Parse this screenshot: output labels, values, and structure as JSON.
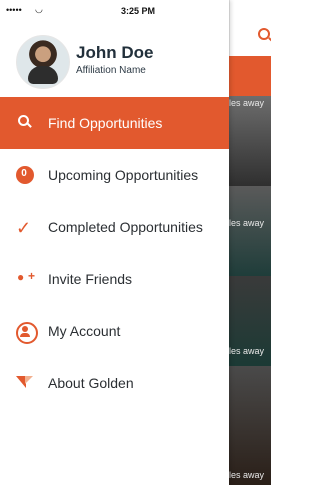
{
  "status": {
    "signal": "•••••",
    "time": "3:25 PM"
  },
  "profile": {
    "name": "John Doe",
    "affiliation": "Affiliation Name"
  },
  "menu": {
    "items": [
      {
        "label": "Find Opportunities",
        "icon": "search-icon",
        "active": true
      },
      {
        "label": "Upcoming Opportunities",
        "icon": "badge-icon",
        "badge": "0",
        "active": false
      },
      {
        "label": "Completed Opportunities",
        "icon": "check-icon",
        "active": false
      },
      {
        "label": "Invite Friends",
        "icon": "add-user-icon",
        "active": false
      },
      {
        "label": "My Account",
        "icon": "account-icon",
        "active": false
      },
      {
        "label": "About Golden",
        "icon": "golden-logo-icon",
        "active": false
      }
    ]
  },
  "background": {
    "captions": [
      "les away",
      "les away",
      "les away",
      "les away"
    ]
  },
  "colors": {
    "accent": "#e2592e",
    "text": "#2b2f33",
    "name": "#22303b"
  }
}
